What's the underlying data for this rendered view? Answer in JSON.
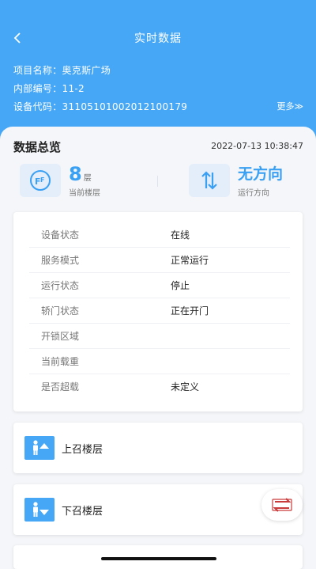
{
  "header": {
    "title": "实时数据",
    "project_label": "项目名称：",
    "project_value": "奥克斯广场",
    "internal_label": "内部编号：",
    "internal_value": "11-2",
    "device_label": "设备代码：",
    "device_value": "3110510100201210017 9",
    "more_label": "更多≫"
  },
  "overview": {
    "title": "数据总览",
    "timestamp": "2022-07-13 10:38:47",
    "floor_value": "8",
    "floor_unit": "层",
    "floor_label": "当前楼层",
    "direction_value": "无方向",
    "direction_label": "运行方向"
  },
  "status_rows": [
    {
      "label": "设备状态",
      "value": "在线"
    },
    {
      "label": "服务模式",
      "value": "正常运行"
    },
    {
      "label": "运行状态",
      "value": "停止"
    },
    {
      "label": "轿门状态",
      "value": "正在开门"
    },
    {
      "label": "开锁区域",
      "value": ""
    },
    {
      "label": "当前载重",
      "value": ""
    },
    {
      "label": "是否超载",
      "value": "未定义"
    }
  ],
  "calls": {
    "up_label": "上召楼层",
    "down_label": "下召楼层"
  },
  "colors": {
    "accent": "#45a7f6",
    "fab_icon": "#c93a3a"
  }
}
